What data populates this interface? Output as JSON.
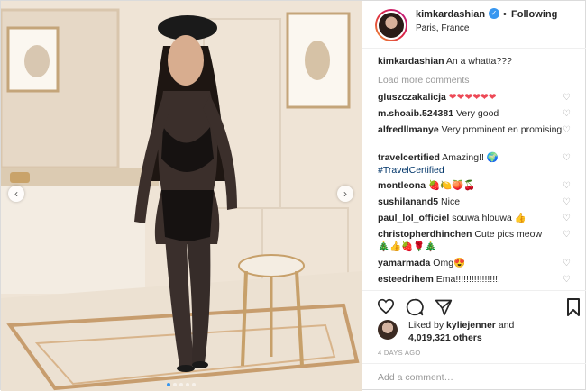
{
  "header": {
    "username": "kimkardashian",
    "verified_icon": "verified-badge-icon",
    "follow_status": "Following",
    "separator": "•",
    "location": "Paris, France"
  },
  "caption": {
    "username": "kimkardashian",
    "text": "An a whatta???"
  },
  "load_more": "Load more comments",
  "comments": [
    {
      "user": "gluszczakalicja",
      "text": "❤❤❤❤❤❤"
    },
    {
      "user": "m.shoaib.524381",
      "text": "Very good"
    },
    {
      "user": "alfredllmanye",
      "text": "Very prominent en promising"
    },
    {
      "user": "travelcertified",
      "text": "Amazing!! 🌍",
      "hashtag": "#TravelCertified"
    },
    {
      "user": "montleona",
      "text": "🍓🍋🍑🍒"
    },
    {
      "user": "sushilanand5",
      "text": "Nice"
    },
    {
      "user": "paul_lol_officiel",
      "text": "souwa hlouwa 👍"
    },
    {
      "user": "christopherdhinchen",
      "text": "Cute pics meow",
      "line2": "🎄👍🍓🌹🎄"
    },
    {
      "user": "yamarmada",
      "text": "Omg😍"
    },
    {
      "user": "esteedrihem",
      "text": "Ema!!!!!!!!!!!!!!!!!"
    }
  ],
  "likes": {
    "prefix": "Liked by",
    "user": "kyliejenner",
    "joiner": "and",
    "count": "4,019,321 others"
  },
  "time_ago": "4 DAYS AGO",
  "add_comment_placeholder": "Add a comment…",
  "carousel": {
    "total_slides": 5,
    "active_slide": 1,
    "prev_label": "‹",
    "next_label": "›"
  },
  "colors": {
    "accent_blue": "#3897f0",
    "heart_red": "#ed4956",
    "muted": "#999999",
    "hashtag": "#003569"
  }
}
